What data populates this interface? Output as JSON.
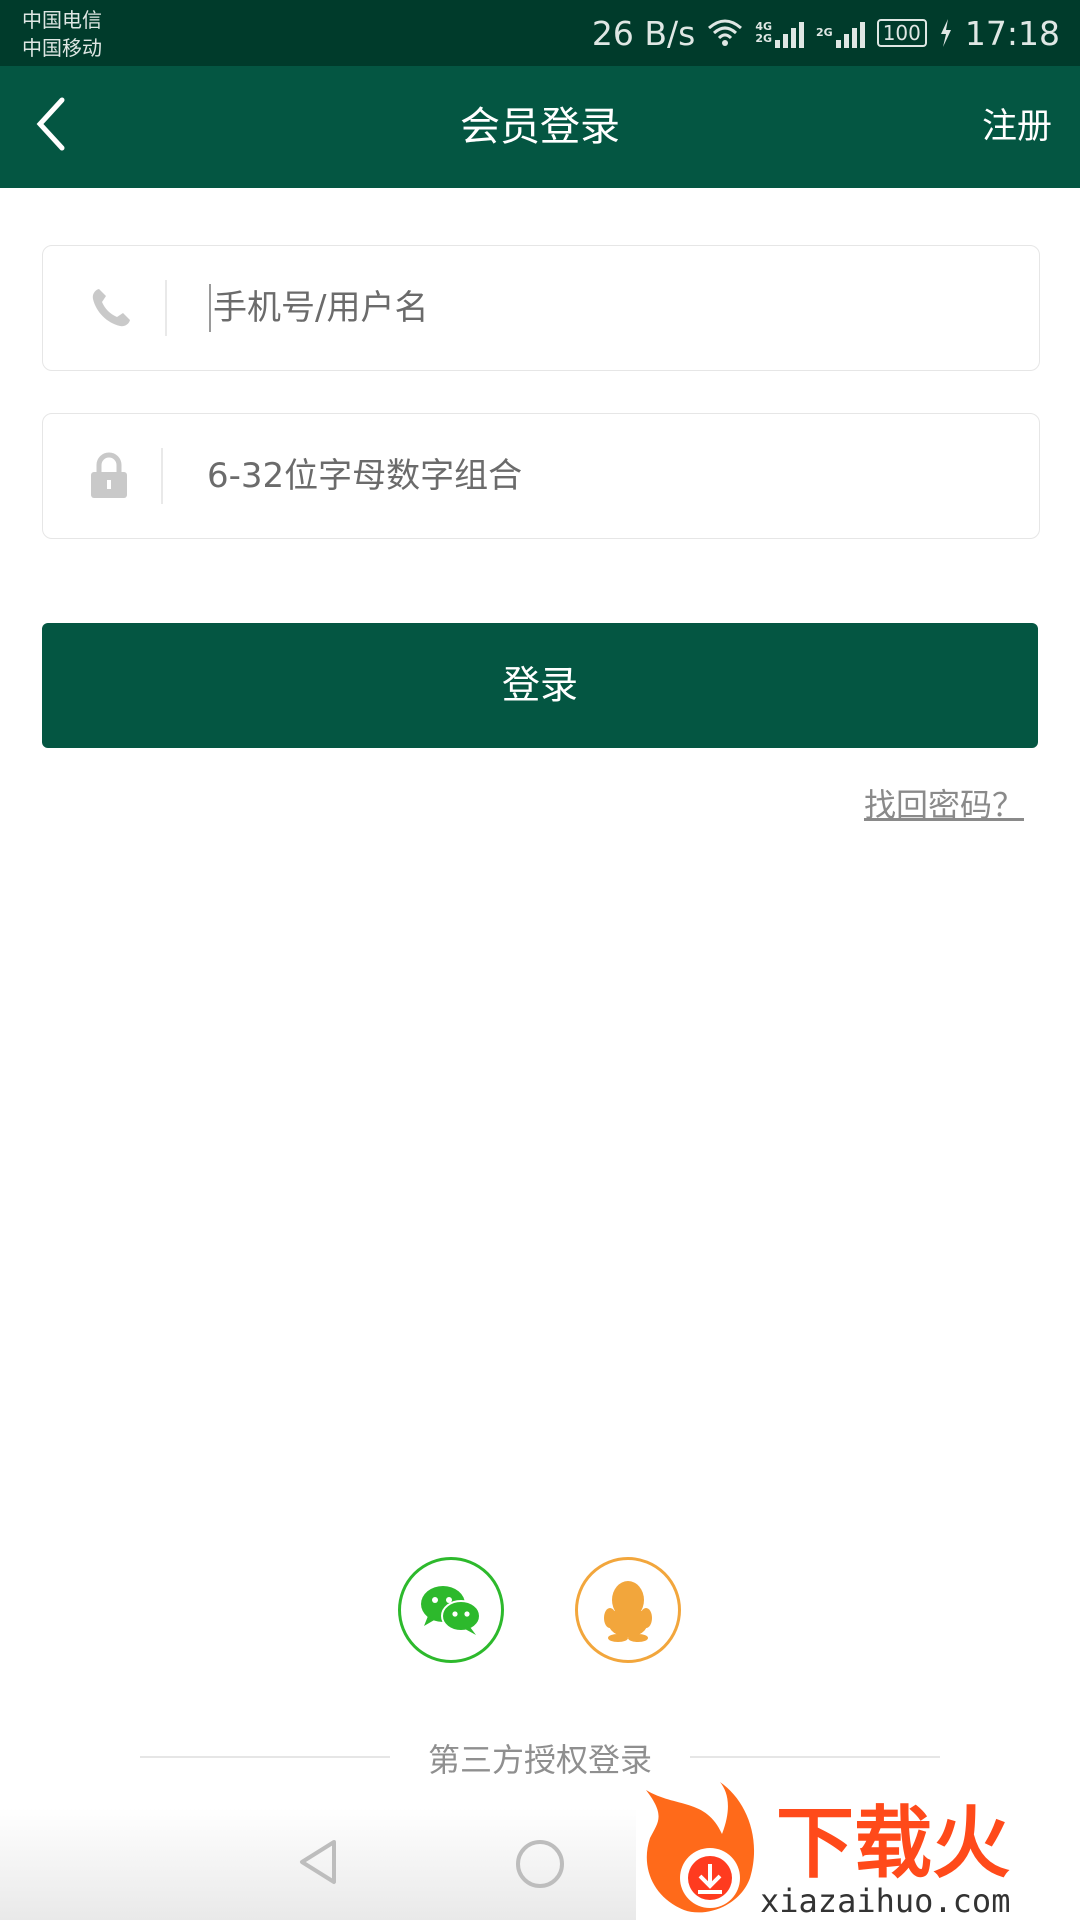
{
  "status_bar": {
    "carrier1": "中国电信",
    "carrier2": "中国移动",
    "speed": "26 B/s",
    "net_a": "4G",
    "net_b": "2G",
    "net_c": "2G",
    "battery": "100",
    "time": "17:18"
  },
  "header": {
    "title": "会员登录",
    "register": "注册"
  },
  "form": {
    "username_placeholder": "手机号/用户名",
    "password_placeholder": "6-32位字母数字组合",
    "login_label": "登录",
    "forgot_label": "找回密码？"
  },
  "social": {
    "label": "第三方授权登录"
  },
  "watermark": {
    "brand": "下载火",
    "domain": "xiazaihuo.com"
  },
  "colors": {
    "primary": "#045642",
    "status_bar": "#003b2b",
    "wechat": "#2db92c",
    "qq": "#f2a63c"
  }
}
